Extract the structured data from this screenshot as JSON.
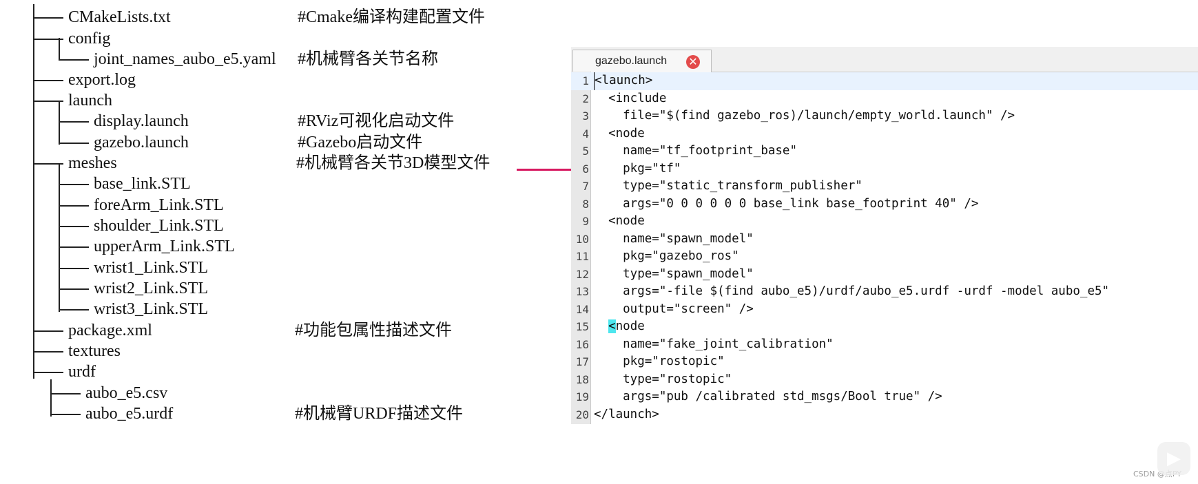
{
  "tree": {
    "rows": [
      {
        "name": "CMakeLists.txt",
        "comment": "#Cmake编译构建配置文件"
      },
      {
        "name": "config",
        "comment": ""
      },
      {
        "name": "joint_names_aubo_e5.yaml",
        "comment": "#机械臂各关节名称"
      },
      {
        "name": "export.log",
        "comment": ""
      },
      {
        "name": "launch",
        "comment": ""
      },
      {
        "name": "display.launch",
        "comment": "#RViz可视化启动文件"
      },
      {
        "name": "gazebo.launch",
        "comment": "#Gazebo启动文件"
      },
      {
        "name": "meshes",
        "comment": "#机械臂各关节3D模型文件"
      },
      {
        "name": "base_link.STL",
        "comment": ""
      },
      {
        "name": "foreArm_Link.STL",
        "comment": ""
      },
      {
        "name": "shoulder_Link.STL",
        "comment": ""
      },
      {
        "name": "upperArm_Link.STL",
        "comment": ""
      },
      {
        "name": "wrist1_Link.STL",
        "comment": ""
      },
      {
        "name": "wrist2_Link.STL",
        "comment": ""
      },
      {
        "name": "wrist3_Link.STL",
        "comment": ""
      },
      {
        "name": "package.xml",
        "comment": "#功能包属性描述文件"
      },
      {
        "name": "textures",
        "comment": ""
      },
      {
        "name": "urdf",
        "comment": ""
      },
      {
        "name": "aubo_e5.csv",
        "comment": ""
      },
      {
        "name": "aubo_e5.urdf",
        "comment": "#机械臂URDF描述文件"
      }
    ]
  },
  "editor": {
    "tab_title": "gazebo.launch",
    "close_icon": "close-icon",
    "lines": [
      {
        "n": "1",
        "text": "<launch>"
      },
      {
        "n": "2",
        "text": "  <include"
      },
      {
        "n": "3",
        "text": "    file=\"$(find gazebo_ros)/launch/empty_world.launch\" />"
      },
      {
        "n": "4",
        "text": "  <node"
      },
      {
        "n": "5",
        "text": "    name=\"tf_footprint_base\""
      },
      {
        "n": "6",
        "text": "    pkg=\"tf\""
      },
      {
        "n": "7",
        "text": "    type=\"static_transform_publisher\""
      },
      {
        "n": "8",
        "text": "    args=\"0 0 0 0 0 0 base_link base_footprint 40\" />"
      },
      {
        "n": "9",
        "text": "  <node"
      },
      {
        "n": "10",
        "text": "    name=\"spawn_model\""
      },
      {
        "n": "11",
        "text": "    pkg=\"gazebo_ros\""
      },
      {
        "n": "12",
        "text": "    type=\"spawn_model\""
      },
      {
        "n": "13",
        "text": "    args=\"-file $(find aubo_e5)/urdf/aubo_e5.urdf -urdf -model aubo_e5\""
      },
      {
        "n": "14",
        "text": "    output=\"screen\" />"
      },
      {
        "n": "15",
        "text": "  <node"
      },
      {
        "n": "16",
        "text": "    name=\"fake_joint_calibration\""
      },
      {
        "n": "17",
        "text": "    pkg=\"rostopic\""
      },
      {
        "n": "18",
        "text": "    type=\"rostopic\""
      },
      {
        "n": "19",
        "text": "    args=\"pub /calibrated std_msgs/Bool true\" />"
      },
      {
        "n": "20",
        "text": "</launch>"
      }
    ],
    "bracket_match_color": "#4ee6ee",
    "current_line_color": "#e8f2fe"
  },
  "connector_color": "#d7175f",
  "watermark": "CSDN @点PY",
  "play_icon": "play-icon"
}
